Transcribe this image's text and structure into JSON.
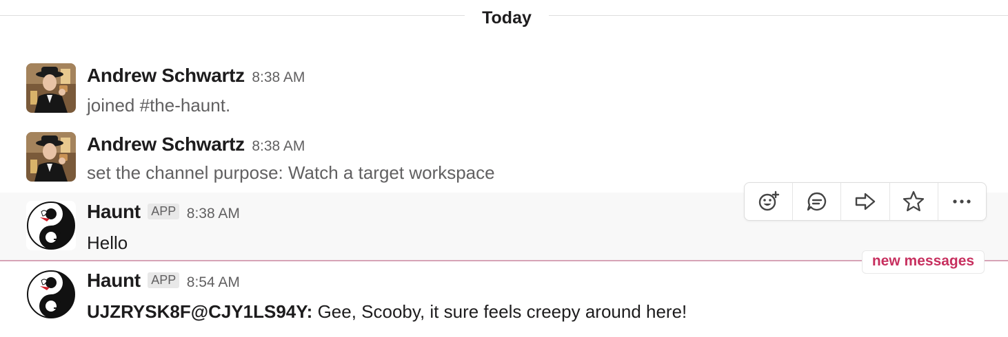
{
  "day_divider": {
    "label": "Today"
  },
  "messages": [
    {
      "author": "Andrew Schwartz",
      "time": "8:38 AM",
      "text": "joined #the-haunt."
    },
    {
      "author": "Andrew Schwartz",
      "time": "8:38 AM",
      "text": "set the channel purpose: Watch a target workspace"
    },
    {
      "author": "Haunt",
      "badge": "APP",
      "time": "8:38 AM",
      "text": "Hello"
    },
    {
      "author": "Haunt",
      "badge": "APP",
      "time": "8:54 AM",
      "mention": "UJZRYSK8F@CJY1LS94Y:",
      "text": " Gee, Scooby, it sure feels creepy around here!"
    }
  ],
  "message_actions": [
    {
      "icon": "add-reaction-icon"
    },
    {
      "icon": "reply-thread-icon"
    },
    {
      "icon": "share-message-icon"
    },
    {
      "icon": "star-icon"
    },
    {
      "icon": "more-actions-icon"
    }
  ],
  "new_messages": {
    "label": "new messages",
    "color": "#c7305f"
  }
}
